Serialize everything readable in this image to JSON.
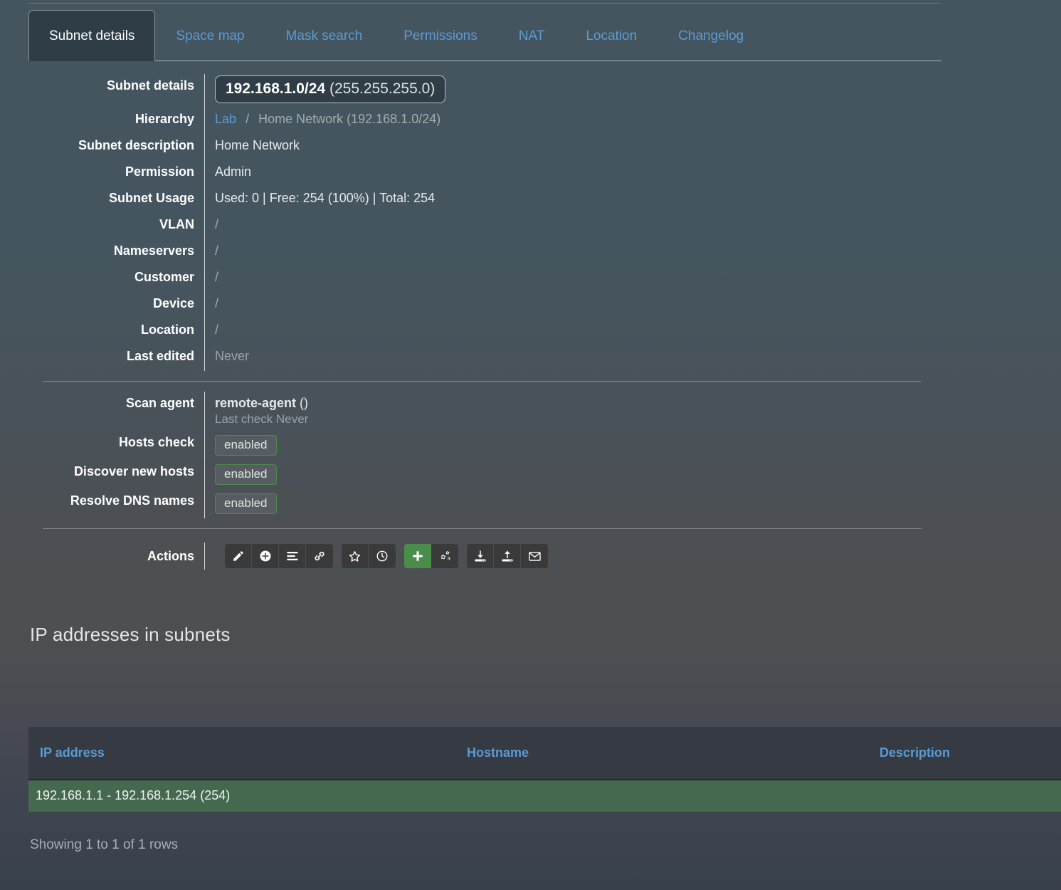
{
  "tabs": [
    {
      "label": "Subnet details",
      "active": true
    },
    {
      "label": "Space map",
      "active": false
    },
    {
      "label": "Mask search",
      "active": false
    },
    {
      "label": "Permissions",
      "active": false
    },
    {
      "label": "NAT",
      "active": false
    },
    {
      "label": "Location",
      "active": false
    },
    {
      "label": "Changelog",
      "active": false
    }
  ],
  "details": {
    "subnet_label": "Subnet details",
    "subnet_cidr": "192.168.1.0/24",
    "subnet_mask": "(255.255.255.0)",
    "hierarchy_label": "Hierarchy",
    "hierarchy_root": "Lab",
    "hierarchy_sep": "/",
    "hierarchy_current": "Home Network (192.168.1.0/24)",
    "description_label": "Subnet description",
    "description_value": "Home Network",
    "permission_label": "Permission",
    "permission_value": "Admin",
    "usage_label": "Subnet Usage",
    "usage_value": "Used: 0 | Free: 254 (100%) | Total: 254",
    "vlan_label": "VLAN",
    "vlan_value": "/",
    "nameservers_label": "Nameservers",
    "nameservers_value": "/",
    "customer_label": "Customer",
    "customer_value": "/",
    "device_label": "Device",
    "device_value": "/",
    "location_label": "Location",
    "location_value": "/",
    "last_edited_label": "Last edited",
    "last_edited_value": "Never"
  },
  "scan": {
    "agent_label": "Scan agent",
    "agent_value": "remote-agent",
    "agent_suffix": "()",
    "last_check": "Last check Never",
    "hosts_check_label": "Hosts check",
    "hosts_check_value": "enabled",
    "discover_label": "Discover new hosts",
    "discover_value": "enabled",
    "resolve_dns_label": "Resolve DNS names",
    "resolve_dns_value": "enabled"
  },
  "actions": {
    "label": "Actions",
    "groups": [
      [
        {
          "icon": "pencil-icon",
          "name": "edit-subnet-button",
          "green": false
        },
        {
          "icon": "plus-circle-icon",
          "name": "add-subnet-button",
          "green": false
        },
        {
          "icon": "list-icon",
          "name": "split-subnet-button",
          "green": false
        },
        {
          "icon": "link-icon",
          "name": "link-subnet-button",
          "green": false
        }
      ],
      [
        {
          "icon": "star-icon",
          "name": "favourite-button",
          "green": false
        },
        {
          "icon": "clock-icon",
          "name": "history-button",
          "green": false
        }
      ],
      [
        {
          "icon": "plus-icon",
          "name": "add-ip-address-button",
          "green": true
        },
        {
          "icon": "gears-icon",
          "name": "scan-settings-button",
          "green": false
        }
      ],
      [
        {
          "icon": "download-icon",
          "name": "import-button",
          "green": false
        },
        {
          "icon": "upload-icon",
          "name": "export-button",
          "green": false
        },
        {
          "icon": "envelope-icon",
          "name": "email-button",
          "green": false
        }
      ]
    ]
  },
  "ip_section": {
    "title": "IP addresses in subnets",
    "columns": [
      "IP address",
      "Hostname",
      "Description"
    ],
    "rows": [
      {
        "ip": "192.168.1.1 - 192.168.1.254 (254)",
        "hostname": "",
        "description": ""
      }
    ],
    "footer": "Showing 1 to 1 of 1 rows"
  },
  "colors": {
    "link": "#5b9bd5",
    "accent_green": "#4a8c4a",
    "row_green": "#44694f",
    "panel_dark": "#2f3d46",
    "header_dark": "#363a43"
  }
}
